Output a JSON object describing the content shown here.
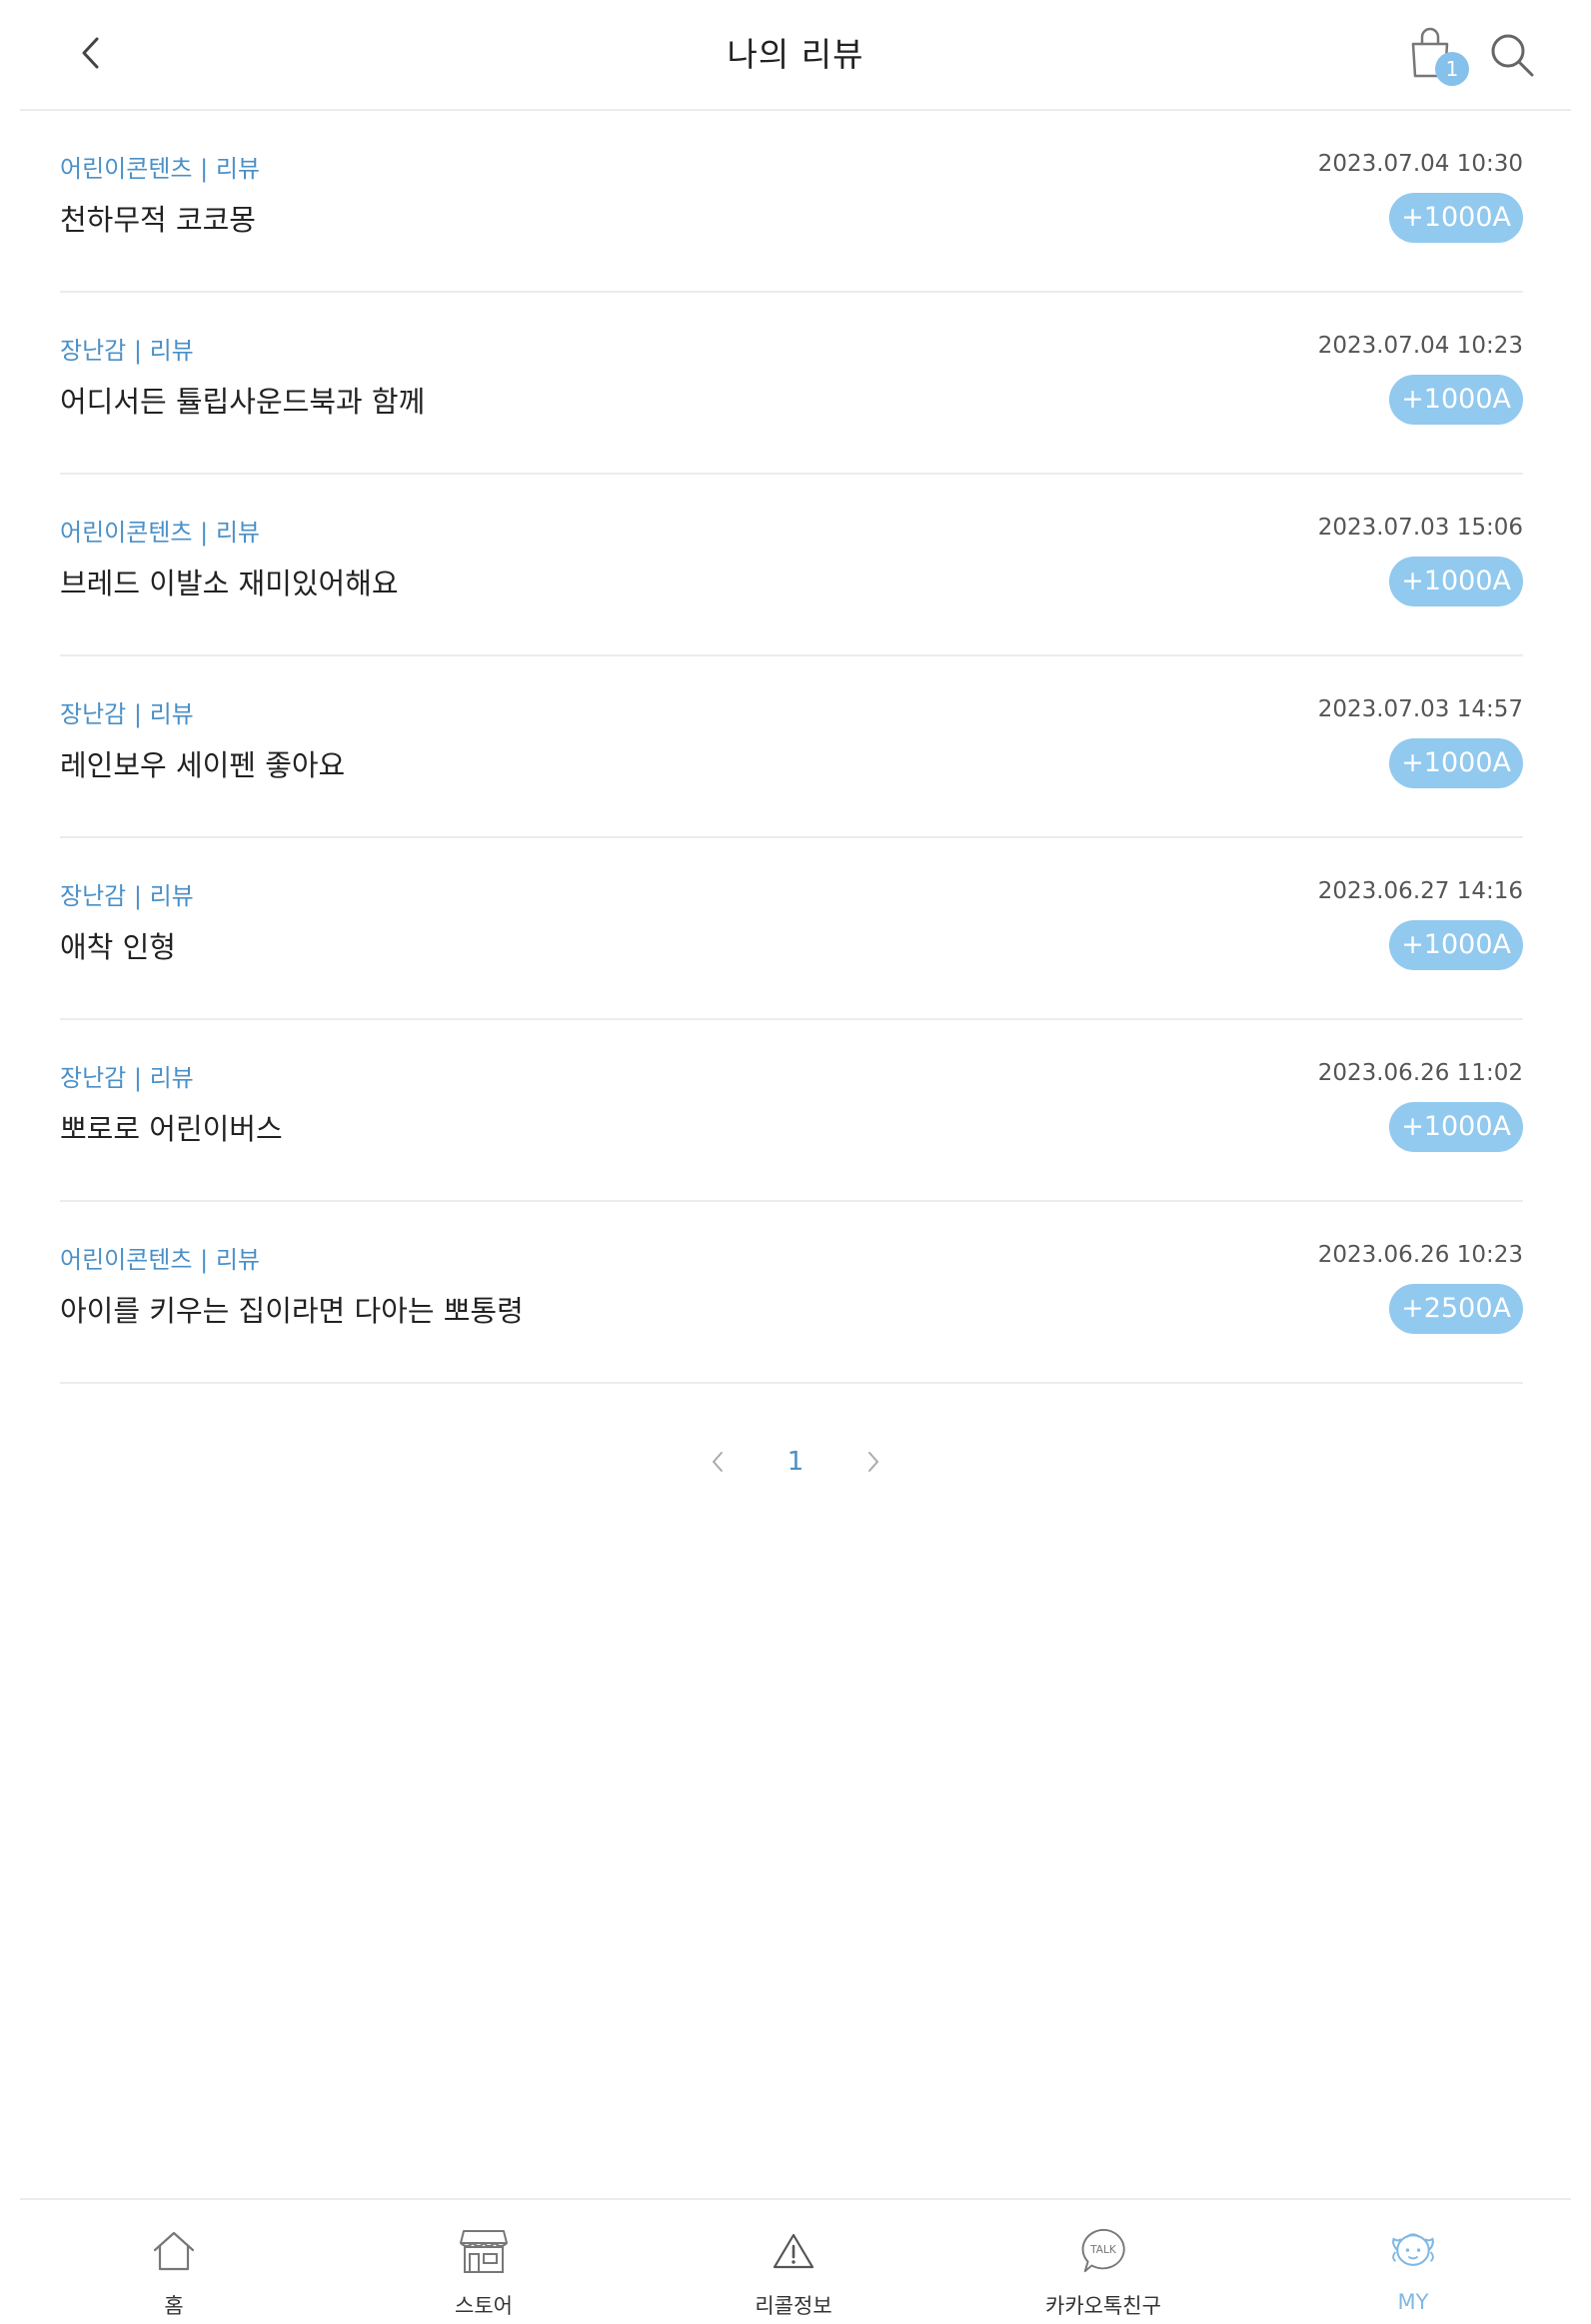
{
  "header": {
    "title": "나의 리뷰",
    "back_icon": "chevron-left-icon",
    "cart_icon": "shopping-bag-icon",
    "cart_count": "1",
    "search_icon": "search-icon"
  },
  "reviews": [
    {
      "category": "어린이콘텐츠 | 리뷰",
      "title": "천하무적 코코몽",
      "date": "2023.07.04 10:30",
      "points": "+1000A"
    },
    {
      "category": "장난감 | 리뷰",
      "title": "어디서든 튤립사운드북과 함께",
      "date": "2023.07.04 10:23",
      "points": "+1000A"
    },
    {
      "category": "어린이콘텐츠 | 리뷰",
      "title": "브레드 이발소 재미있어해요",
      "date": "2023.07.03 15:06",
      "points": "+1000A"
    },
    {
      "category": "장난감 | 리뷰",
      "title": "레인보우 세이펜 좋아요",
      "date": "2023.07.03 14:57",
      "points": "+1000A"
    },
    {
      "category": "장난감 | 리뷰",
      "title": "애착 인형",
      "date": "2023.06.27 14:16",
      "points": "+1000A"
    },
    {
      "category": "장난감 | 리뷰",
      "title": "뽀로로 어린이버스",
      "date": "2023.06.26 11:02",
      "points": "+1000A"
    },
    {
      "category": "어린이콘텐츠 | 리뷰",
      "title": "아이를 키우는 집이라면 다아는 뽀통령",
      "date": "2023.06.26 10:23",
      "points": "+2500A"
    }
  ],
  "pagination": {
    "current_page": "1",
    "prev_icon": "chevron-left-icon",
    "next_icon": "chevron-right-icon"
  },
  "bottom_nav": [
    {
      "label": "홈",
      "icon": "home-icon",
      "active": false
    },
    {
      "label": "스토어",
      "icon": "store-icon",
      "active": false
    },
    {
      "label": "리콜정보",
      "icon": "warning-icon",
      "active": false
    },
    {
      "label": "카카오톡친구",
      "icon": "talk-bubble-icon",
      "active": false
    },
    {
      "label": "MY",
      "icon": "baby-face-icon",
      "active": true
    }
  ],
  "colors": {
    "accent": "#4a90c8",
    "badge": "#92c9ef",
    "active_nav": "#7fb8e4",
    "divider": "#ececec"
  }
}
